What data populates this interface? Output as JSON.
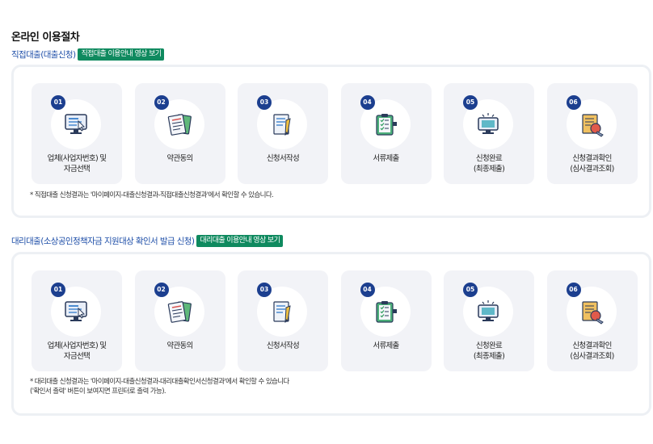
{
  "page_title": "온라인 이용절차",
  "sections": [
    {
      "title": "직접대출(대출신청)",
      "video_button": "직접대출 이용안내 영상 보기",
      "steps": [
        {
          "num": "01",
          "label1": "업체(사업자번호) 및",
          "label2": "자금선택",
          "icon": "monitor-cursor-icon"
        },
        {
          "num": "02",
          "label1": "약관동의",
          "label2": "",
          "icon": "documents-icon"
        },
        {
          "num": "03",
          "label1": "신청서작성",
          "label2": "",
          "icon": "pen-writing-icon"
        },
        {
          "num": "04",
          "label1": "서류제출",
          "label2": "",
          "icon": "clipboard-checklist-icon"
        },
        {
          "num": "05",
          "label1": "신청완료",
          "label2": "(최종제출)",
          "icon": "monitor-alert-icon"
        },
        {
          "num": "06",
          "label1": "신청결과확인",
          "label2": "(심사결과조회)",
          "icon": "stamp-document-icon"
        }
      ],
      "note1": "* 직접대출 신청결과는 '마이페이지-대출신청결과-직접대출신청결과'에서 확인할 수 있습니다.",
      "note2": ""
    },
    {
      "title": "대리대출(소상공인정책자금 지원대상 확인서 발급 신청)",
      "video_button": "대리대출 이용안내 영상 보기",
      "steps": [
        {
          "num": "01",
          "label1": "업체(사업자번호) 및",
          "label2": "자금선택",
          "icon": "monitor-cursor-icon"
        },
        {
          "num": "02",
          "label1": "약관동의",
          "label2": "",
          "icon": "documents-icon"
        },
        {
          "num": "03",
          "label1": "신청서작성",
          "label2": "",
          "icon": "pen-writing-icon"
        },
        {
          "num": "04",
          "label1": "서류제출",
          "label2": "",
          "icon": "clipboard-checklist-icon"
        },
        {
          "num": "05",
          "label1": "신청완료",
          "label2": "(최종제출)",
          "icon": "monitor-alert-icon"
        },
        {
          "num": "06",
          "label1": "신청결과확인",
          "label2": "(심사결과조회)",
          "icon": "stamp-document-icon"
        }
      ],
      "note1": "* 대리대출 신청결과는 '마이페이지-대출신청결과-대리대출확인서신청결과'에서 확인할 수 있습니다",
      "note2": "('확인서 출력' 버튼이 보여지면 프린터로 출력 가능)."
    }
  ],
  "colors": {
    "accent": "#1c3f8f",
    "video_button": "#0f8a5f",
    "section_title": "#1f4fa8",
    "step_bg": "#f2f3f7"
  }
}
